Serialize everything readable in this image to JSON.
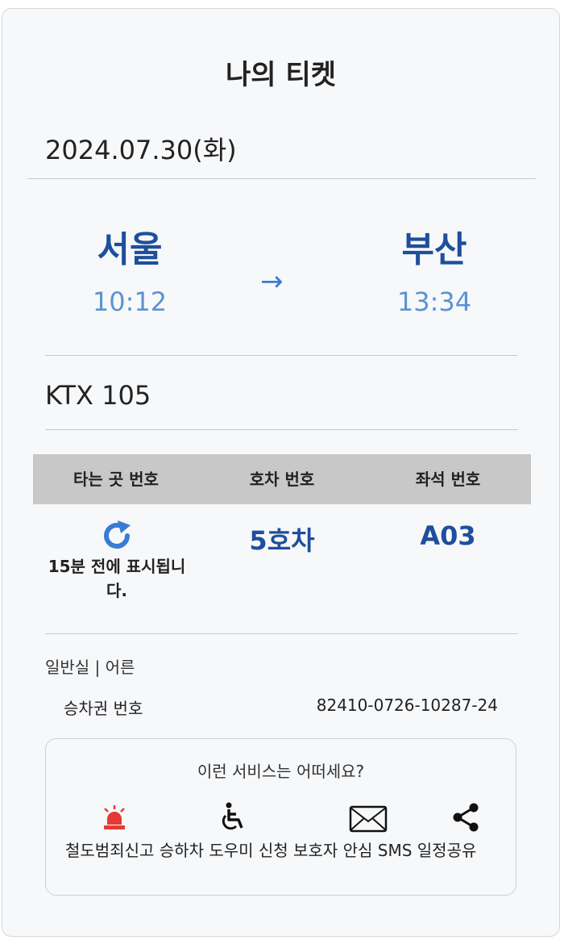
{
  "header": {
    "title": "나의 티켓"
  },
  "trip": {
    "date": "2024.07.30(화)",
    "departure": {
      "station": "서울",
      "time": "10:12"
    },
    "arrow": "→",
    "arrival": {
      "station": "부산",
      "time": "13:34"
    },
    "train": "KTX 105"
  },
  "seat_table": {
    "headers": [
      "타는 곳 번호",
      "호차 번호",
      "좌석 번호"
    ],
    "platform_note": "15분 전에 표시됩니다.",
    "car": "5호차",
    "seat": "A03"
  },
  "ticket": {
    "class_info": "일반실 | 어른",
    "number_label": "승차권 번호",
    "number": "82410-0726-10287-24"
  },
  "services": {
    "title": "이런 서비스는 어떠세요?",
    "items": [
      {
        "label": "철도범죄신고",
        "icon": "siren-icon"
      },
      {
        "label": "승하차 도우미 신청",
        "icon": "wheelchair-icon"
      },
      {
        "label": "보호자 안심 SMS",
        "icon": "envelope-icon"
      },
      {
        "label": "일정공유",
        "icon": "share-icon"
      }
    ]
  },
  "colors": {
    "accent": "#1f4f9c",
    "time": "#5b94d0",
    "refresh": "#3a7bd5",
    "siren": "#e53935"
  }
}
